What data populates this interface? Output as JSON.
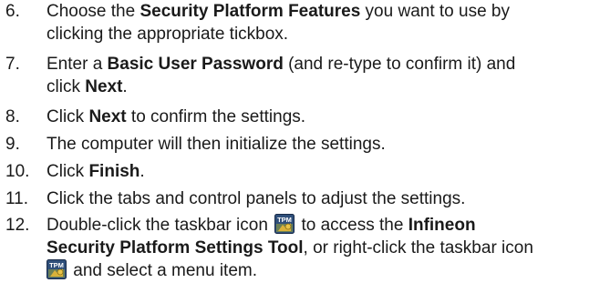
{
  "steps": [
    {
      "number": "6.",
      "p1": "Choose the ",
      "b1": "Security Platform Features",
      "p2": " you want to use by",
      "p3": "clicking the appropriate tickbox."
    },
    {
      "number": "7.",
      "p1": "Enter a ",
      "b1": "Basic User Password",
      "p2": " (and re-type to confirm it) and",
      "p3": "click ",
      "b2": "Next",
      "p4": "."
    },
    {
      "number": "8.",
      "p1": "Click ",
      "b1": "Next",
      "p2": " to confirm the settings."
    },
    {
      "number": "9.",
      "p1": "The computer will then initialize the settings."
    },
    {
      "number": "10.",
      "p1": "Click ",
      "b1": "Finish",
      "p2": "."
    },
    {
      "number": "11.",
      "p1": "Click the tabs and control panels to adjust the settings."
    },
    {
      "number": "12.",
      "p1": "Double-click the taskbar icon",
      "p2": " to access the ",
      "b1": "Infineon",
      "b2": "Security Platform Settings Tool",
      "p3": ", or right-click the taskbar icon",
      "p4": " and select a menu item."
    }
  ],
  "icons": {
    "tpm_icon_text": "TPM",
    "tpm_icon_name": "tpm-taskbar-icon"
  }
}
